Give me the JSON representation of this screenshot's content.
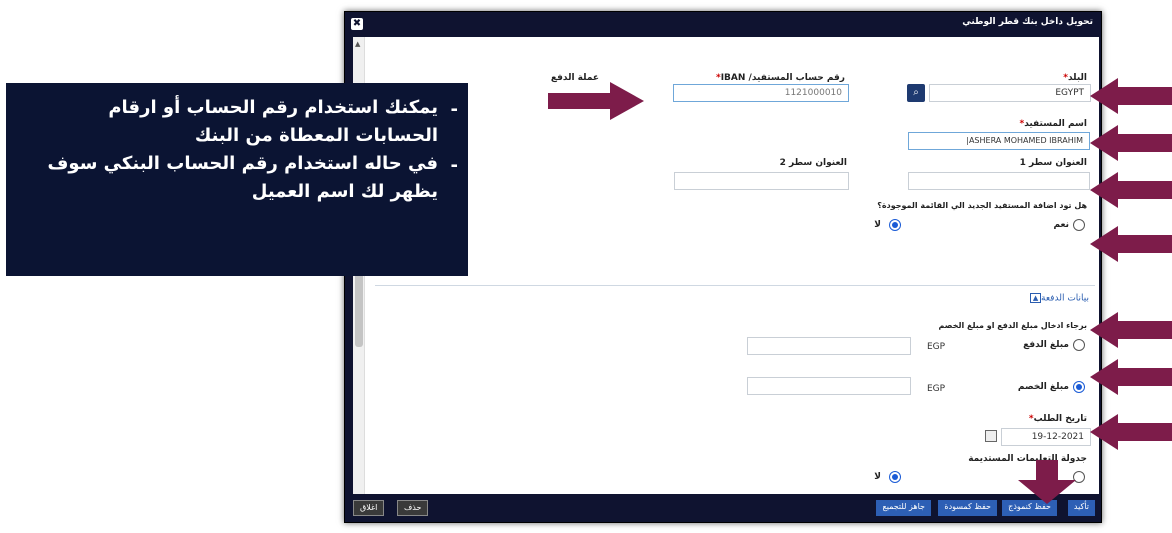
{
  "dialog": {
    "title": "تحويل داخل بنك قطر الوطني",
    "close_glyph": "✖"
  },
  "form": {
    "bank_label": "البلد",
    "bank_value": "EGYPT",
    "iban_label": "رقم حساب المستفيد/ IBAN",
    "iban_value": "1121000010",
    "currency_label": "عملة الدفع",
    "currency_value": "EGP",
    "beneficiary_label": "اسم المستفيد",
    "beneficiary_value": "|ASHERA MOHAMED IBRAHIM",
    "address1_label": "العنوان سطر 1",
    "address1_value": "",
    "address2_label": "العنوان سطر 2",
    "address2_value": "",
    "add_question": "هل تود اضافة المستفيد الجديد الي القائمة الموجودة؟",
    "yes_label": "نعم",
    "no_label": "لا",
    "payment_section": "بيانات الدفعة",
    "amount_instruction": "برجاء ادخال مبلغ الدفع او مبلغ الخصم",
    "payment_amount_label": "مبلغ الدفع",
    "payment_amount_value": "",
    "payment_unit": "EGP",
    "debit_amount_label": "مبلغ الخصم",
    "debit_amount_value": "",
    "debit_unit": "EGP",
    "request_date_label": "تاريخ الطلب",
    "request_date_value": "19-12-2021",
    "recurring_label": "جدولة التعليمات المستديمة",
    "recurring_no_label": "لا"
  },
  "footer": {
    "confirm": "تأكيد",
    "save_template": "حفظ كنموذج",
    "save_draft": "حفظ كمسودة",
    "ready_to_collect": "جاهز للتجميع",
    "delete": "حذف",
    "close": "اغلاق"
  },
  "callout": {
    "bullet": "-",
    "line1": "يمكنك استخدام رقم الحساب أو ارقام",
    "line2": "الحسابات المعطاة من البنك",
    "line3": "في حاله استخدام رقم الحساب البنكي سوف",
    "line4": "يظهر لك اسم العميل"
  },
  "colors": {
    "arrow": "#7d1c4a",
    "dialog_frame": "#0f1330",
    "callout_bg": "#0b1433",
    "button_blue": "#2d5fb5"
  }
}
